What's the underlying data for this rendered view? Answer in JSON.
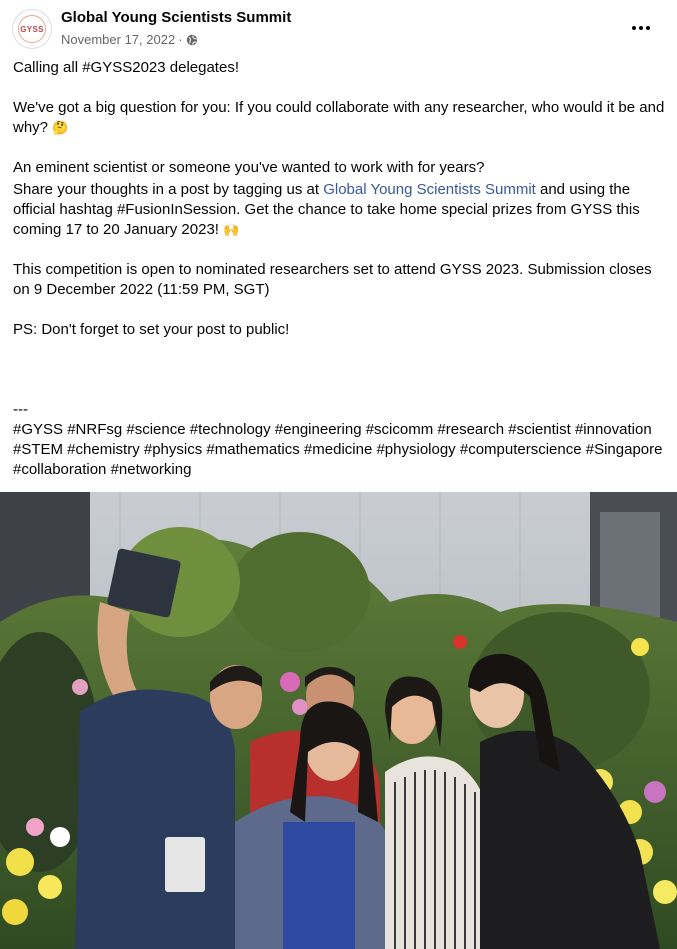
{
  "post": {
    "author": "Global Young Scientists Summit",
    "avatar_text": "GYSS",
    "date": "November 17, 2022",
    "separator": "·",
    "privacy_icon": "globe-icon",
    "more_icon": "more-options-icon"
  },
  "text": {
    "p1": "Calling all #GYSS2023 delegates!",
    "p2": "We've got a big question for you: If you could collaborate with any researcher, who would it be and why?",
    "p2_emoji": "🤔",
    "p3": "An eminent scientist or someone you've wanted to work with for years?",
    "p4_before": "Share your thoughts in a post by tagging us at ",
    "p4_link": "Global Young Scientists Summit",
    "p4_after": " and using the official hashtag #FusionInSession. Get the chance to take home special prizes from GYSS this coming 17 to 20 January 2023!",
    "p4_emoji": "🙌",
    "p5": "This competition is open to nominated researchers set to attend GYSS 2023. Submission closes on 9 December 2022 (11:59 PM, SGT)",
    "p6": "PS: Don't forget to set your post to public!",
    "divider": "---",
    "hashtags": "#GYSS #NRFsg #science #technology #engineering #scicomm #research #scientist #innovation #STEM #chemistry #physics #mathematics #medicine #physiology #computerscience #Singapore #collaboration #networking"
  },
  "colors": {
    "link": "#385898",
    "secondary_text": "#65676b"
  }
}
